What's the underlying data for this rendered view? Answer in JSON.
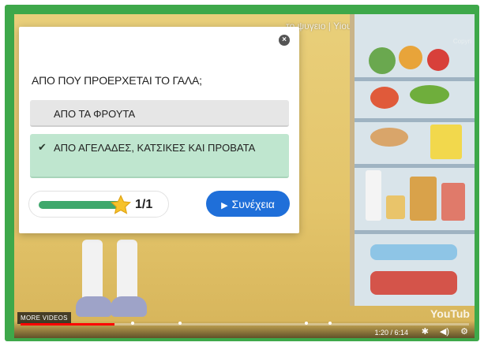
{
  "video": {
    "title": "το ψυγειο | Yioupi Tv",
    "copy_tag": "Copyri",
    "more_videos": "MORE VIDEOS",
    "yt_logo": "YouTub",
    "time": "1:20 / 6:14",
    "progress": 0.21,
    "icons": [
      "settings-icon",
      "volume-icon",
      "gear-icon"
    ]
  },
  "quiz": {
    "question": "ΑΠΟ ΠΟΥ ΠΡΟΕΡΧΕΤΑΙ ΤΟ ΓΑΛΑ;",
    "options": [
      {
        "label": "ΑΠΟ ΤΑ ΦΡΟΥΤΑ",
        "selected": false
      },
      {
        "label": "ΑΠΟ ΑΓΕΛΑΔΕΣ, ΚΑΤΣΙΚΕΣ ΚΑΙ ΠΡΟΒΑΤΑ",
        "selected": true
      }
    ],
    "check_icon": "✔",
    "score_text": "1/1",
    "score_fraction": 1.0,
    "continue_label": "Συνέχεια",
    "close_icon": "×"
  },
  "colors": {
    "frame": "#3ea84a",
    "accent_blue": "#1f6fd9",
    "correct_bg": "#bfe6cf",
    "progress_green": "#3ea86c"
  }
}
